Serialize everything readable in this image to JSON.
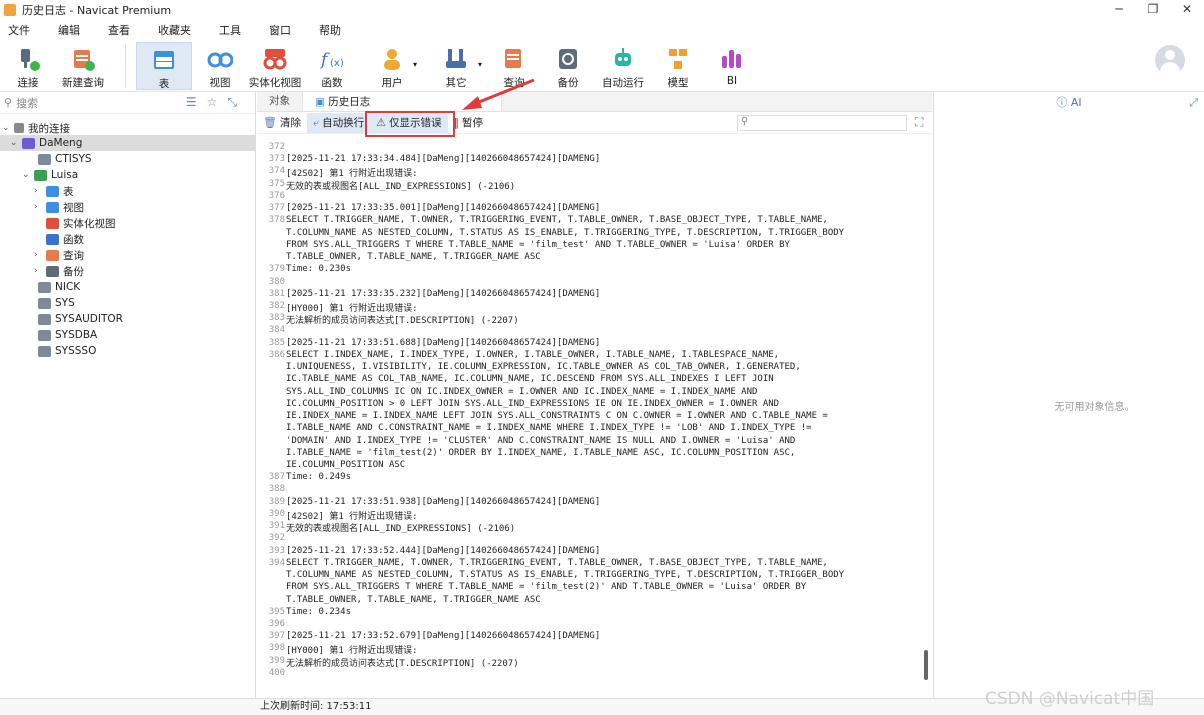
{
  "window": {
    "title": "历史日志 - Navicat Premium"
  },
  "menu": [
    "文件",
    "编辑",
    "查看",
    "收藏夹",
    "工具",
    "窗口",
    "帮助"
  ],
  "toolbar": [
    {
      "label": "连接"
    },
    {
      "label": "新建查询"
    },
    {
      "label": "表"
    },
    {
      "label": "视图"
    },
    {
      "label": "实体化视图"
    },
    {
      "label": "函数"
    },
    {
      "label": "用户"
    },
    {
      "label": "其它"
    },
    {
      "label": "查询"
    },
    {
      "label": "备份"
    },
    {
      "label": "自动运行"
    },
    {
      "label": "模型"
    },
    {
      "label": "BI"
    }
  ],
  "sidebar": {
    "search_placeholder": "搜索",
    "tree": [
      {
        "label": "我的连接"
      },
      {
        "label": "DaMeng"
      },
      {
        "label": "CTISYS"
      },
      {
        "label": "Luisa"
      },
      {
        "label": "表"
      },
      {
        "label": "视图"
      },
      {
        "label": "实体化视图"
      },
      {
        "label": "函数"
      },
      {
        "label": "查询"
      },
      {
        "label": "备份"
      },
      {
        "label": "NICK"
      },
      {
        "label": "SYS"
      },
      {
        "label": "SYSAUDITOR"
      },
      {
        "label": "SYSDBA"
      },
      {
        "label": "SYSSSO"
      }
    ]
  },
  "tabs": [
    {
      "label": "对象"
    },
    {
      "label": "历史日志"
    }
  ],
  "actions": {
    "clear": "清除",
    "autowrap": "自动换行",
    "errors_only": "仅显示错误",
    "pause": "暂停"
  },
  "log": [
    {
      "n": "372",
      "t": ""
    },
    {
      "n": "373",
      "t": "[2025-11-21 17:33:34.484][DaMeng][140266048657424][DAMENG]"
    },
    {
      "n": "374",
      "t": "[42S02] 第1 行附近出现错误:"
    },
    {
      "n": "375",
      "t": "无效的表或视图名[ALL_IND_EXPRESSIONS] (-2106)"
    },
    {
      "n": "376",
      "t": ""
    },
    {
      "n": "377",
      "t": "[2025-11-21 17:33:35.001][DaMeng][140266048657424][DAMENG]"
    },
    {
      "n": "378",
      "t": "SELECT T.TRIGGER_NAME, T.OWNER, T.TRIGGERING_EVENT, T.TABLE_OWNER, T.BASE_OBJECT_TYPE, T.TABLE_NAME,"
    },
    {
      "n": "",
      "t": "T.COLUMN_NAME AS NESTED_COLUMN, T.STATUS AS IS_ENABLE, T.TRIGGERING_TYPE, T.DESCRIPTION, T.TRIGGER_BODY"
    },
    {
      "n": "",
      "t": "FROM SYS.ALL_TRIGGERS T WHERE T.TABLE_NAME = 'film_test' AND T.TABLE_OWNER = 'Luisa' ORDER BY"
    },
    {
      "n": "",
      "t": "T.TABLE_OWNER, T.TABLE_NAME, T.TRIGGER_NAME ASC"
    },
    {
      "n": "379",
      "t": "Time: 0.230s"
    },
    {
      "n": "380",
      "t": ""
    },
    {
      "n": "381",
      "t": "[2025-11-21 17:33:35.232][DaMeng][140266048657424][DAMENG]"
    },
    {
      "n": "382",
      "t": "[HY000] 第1 行附近出现错误:"
    },
    {
      "n": "383",
      "t": "无法解析的成员访问表达式[T.DESCRIPTION] (-2207)"
    },
    {
      "n": "384",
      "t": ""
    },
    {
      "n": "385",
      "t": "[2025-11-21 17:33:51.688][DaMeng][140266048657424][DAMENG]"
    },
    {
      "n": "386",
      "t": "SELECT I.INDEX_NAME, I.INDEX_TYPE, I.OWNER, I.TABLE_OWNER, I.TABLE_NAME, I.TABLESPACE_NAME,"
    },
    {
      "n": "",
      "t": "I.UNIQUENESS, I.VISIBILITY, IE.COLUMN_EXPRESSION, IC.TABLE_OWNER AS COL_TAB_OWNER, I.GENERATED,"
    },
    {
      "n": "",
      "t": "IC.TABLE_NAME AS COL_TAB_NAME, IC.COLUMN_NAME, IC.DESCEND FROM SYS.ALL_INDEXES I LEFT JOIN"
    },
    {
      "n": "",
      "t": "SYS.ALL_IND_COLUMNS IC ON IC.INDEX_OWNER = I.OWNER AND IC.INDEX_NAME = I.INDEX_NAME AND"
    },
    {
      "n": "",
      "t": "IC.COLUMN_POSITION > 0 LEFT JOIN SYS.ALL_IND_EXPRESSIONS IE ON IE.INDEX_OWNER = I.OWNER AND"
    },
    {
      "n": "",
      "t": "IE.INDEX_NAME = I.INDEX_NAME LEFT JOIN SYS.ALL_CONSTRAINTS C ON C.OWNER = I.OWNER AND C.TABLE_NAME ="
    },
    {
      "n": "",
      "t": "I.TABLE_NAME AND C.CONSTRAINT_NAME = I.INDEX_NAME WHERE I.INDEX_TYPE != 'LOB' AND I.INDEX_TYPE !="
    },
    {
      "n": "",
      "t": "'DOMAIN' AND I.INDEX_TYPE != 'CLUSTER' AND C.CONSTRAINT_NAME IS NULL AND I.OWNER = 'Luisa' AND"
    },
    {
      "n": "",
      "t": "I.TABLE_NAME = 'film_test(2)' ORDER BY I.INDEX_NAME, I.TABLE_NAME ASC, IC.COLUMN_POSITION ASC,"
    },
    {
      "n": "",
      "t": "IE.COLUMN_POSITION ASC"
    },
    {
      "n": "387",
      "t": "Time: 0.249s"
    },
    {
      "n": "388",
      "t": ""
    },
    {
      "n": "389",
      "t": "[2025-11-21 17:33:51.938][DaMeng][140266048657424][DAMENG]"
    },
    {
      "n": "390",
      "t": "[42S02] 第1 行附近出现错误:"
    },
    {
      "n": "391",
      "t": "无效的表或视图名[ALL_IND_EXPRESSIONS] (-2106)"
    },
    {
      "n": "392",
      "t": ""
    },
    {
      "n": "393",
      "t": "[2025-11-21 17:33:52.444][DaMeng][140266048657424][DAMENG]"
    },
    {
      "n": "394",
      "t": "SELECT T.TRIGGER_NAME, T.OWNER, T.TRIGGERING_EVENT, T.TABLE_OWNER, T.BASE_OBJECT_TYPE, T.TABLE_NAME,"
    },
    {
      "n": "",
      "t": "T.COLUMN_NAME AS NESTED_COLUMN, T.STATUS AS IS_ENABLE, T.TRIGGERING_TYPE, T.DESCRIPTION, T.TRIGGER_BODY"
    },
    {
      "n": "",
      "t": "FROM SYS.ALL_TRIGGERS T WHERE T.TABLE_NAME = 'film_test(2)' AND T.TABLE_OWNER = 'Luisa' ORDER BY"
    },
    {
      "n": "",
      "t": "T.TABLE_OWNER, T.TABLE_NAME, T.TRIGGER_NAME ASC"
    },
    {
      "n": "395",
      "t": "Time: 0.234s"
    },
    {
      "n": "396",
      "t": ""
    },
    {
      "n": "397",
      "t": "[2025-11-21 17:33:52.679][DaMeng][140266048657424][DAMENG]"
    },
    {
      "n": "398",
      "t": "[HY000] 第1 行附近出现错误:"
    },
    {
      "n": "399",
      "t": "无法解析的成员访问表达式[T.DESCRIPTION] (-2207)"
    },
    {
      "n": "400",
      "t": ""
    }
  ],
  "rightpanel": {
    "header": "AI",
    "empty": "无可用对象信息。"
  },
  "status": {
    "last_refresh": "上次刷新时间: 17:53:11"
  },
  "watermark": "CSDN @Navicat中国"
}
